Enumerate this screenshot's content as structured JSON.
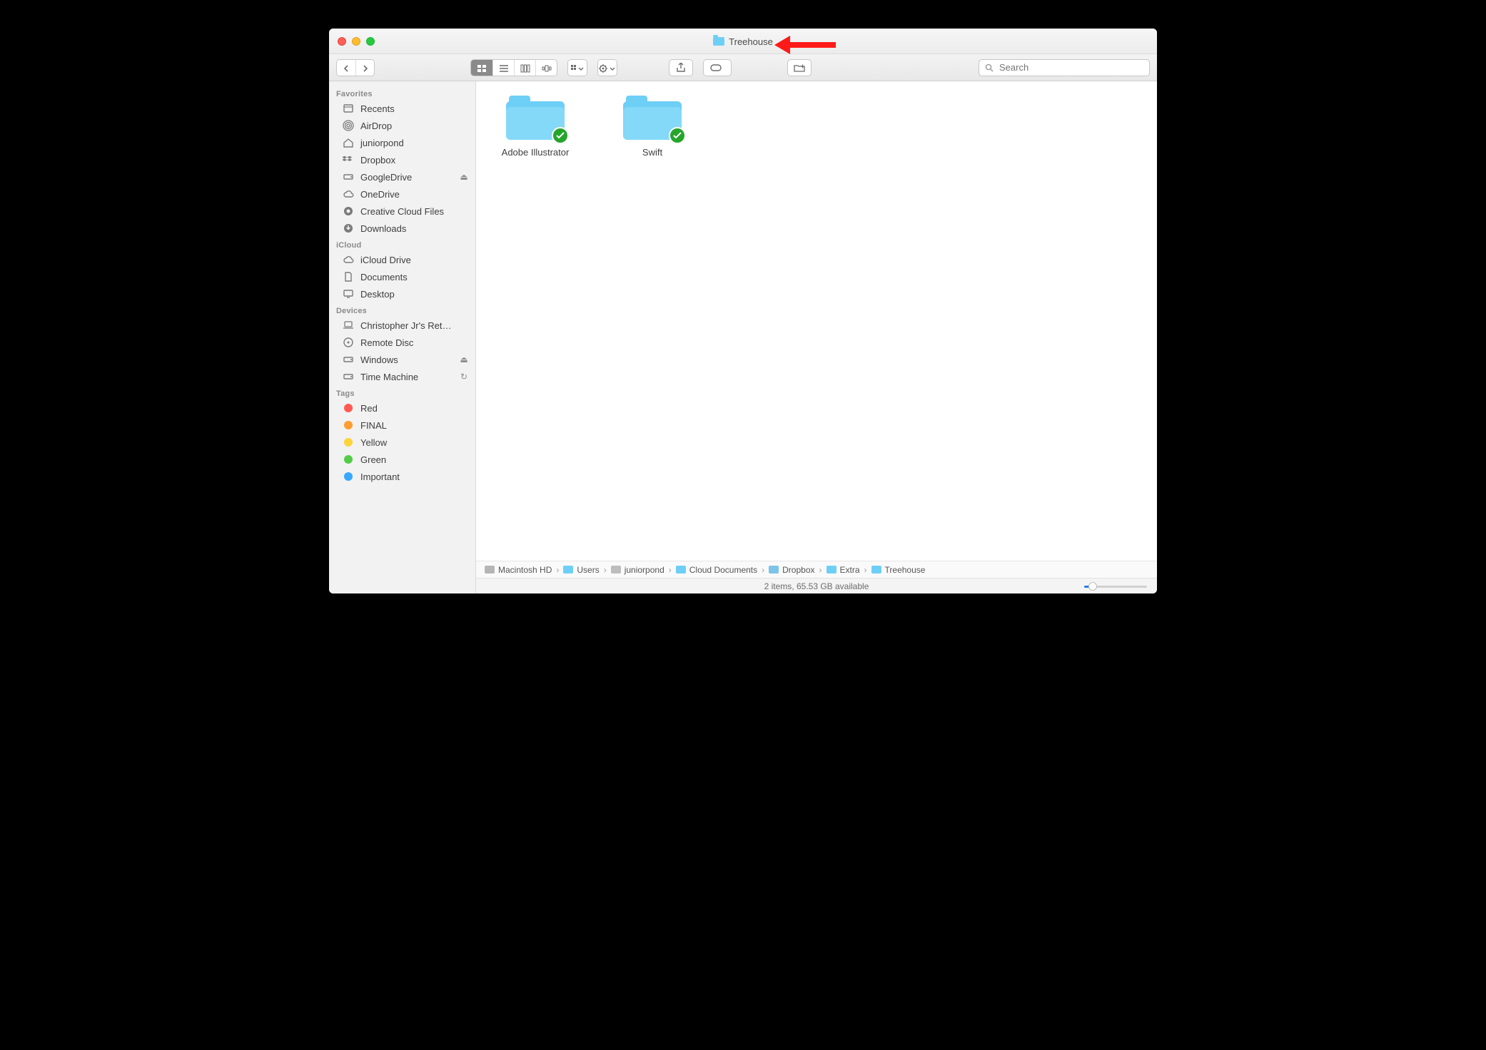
{
  "title": "Treehouse",
  "search": {
    "placeholder": "Search"
  },
  "sidebar": {
    "sections": [
      {
        "label": "Favorites",
        "items": [
          {
            "label": "Recents",
            "icon": "recents"
          },
          {
            "label": "AirDrop",
            "icon": "airdrop"
          },
          {
            "label": "juniorpond",
            "icon": "home"
          },
          {
            "label": "Dropbox",
            "icon": "dropbox"
          },
          {
            "label": "GoogleDrive",
            "icon": "drive",
            "eject": true
          },
          {
            "label": "OneDrive",
            "icon": "cloud"
          },
          {
            "label": "Creative Cloud Files",
            "icon": "cc"
          },
          {
            "label": "Downloads",
            "icon": "downloads"
          }
        ]
      },
      {
        "label": "iCloud",
        "items": [
          {
            "label": "iCloud Drive",
            "icon": "cloud"
          },
          {
            "label": "Documents",
            "icon": "documents"
          },
          {
            "label": "Desktop",
            "icon": "desktop"
          }
        ]
      },
      {
        "label": "Devices",
        "items": [
          {
            "label": "Christopher Jr's Ret…",
            "icon": "laptop"
          },
          {
            "label": "Remote Disc",
            "icon": "disc"
          },
          {
            "label": "Windows",
            "icon": "drive",
            "eject": true
          },
          {
            "label": "Time Machine",
            "icon": "drive",
            "sync": true
          }
        ]
      },
      {
        "label": "Tags",
        "items": [
          {
            "label": "Red",
            "tag": "#ff5a52"
          },
          {
            "label": "FINAL",
            "tag": "#ff9d30"
          },
          {
            "label": "Yellow",
            "tag": "#ffd33c"
          },
          {
            "label": "Green",
            "tag": "#55cc49"
          },
          {
            "label": "Important",
            "tag": "#39a8ff"
          }
        ]
      }
    ]
  },
  "files": [
    {
      "name": "Adobe Illustrator",
      "synced": true
    },
    {
      "name": "Swift",
      "synced": true
    }
  ],
  "path": [
    {
      "label": "Macintosh HD",
      "kind": "hd"
    },
    {
      "label": "Users",
      "kind": "fold"
    },
    {
      "label": "juniorpond",
      "kind": "home"
    },
    {
      "label": "Cloud Documents",
      "kind": "fold"
    },
    {
      "label": "Dropbox",
      "kind": "db"
    },
    {
      "label": "Extra",
      "kind": "fold"
    },
    {
      "label": "Treehouse",
      "kind": "fold"
    }
  ],
  "status": "2 items, 65.53 GB available",
  "annotation": "arrow pointing at window title"
}
